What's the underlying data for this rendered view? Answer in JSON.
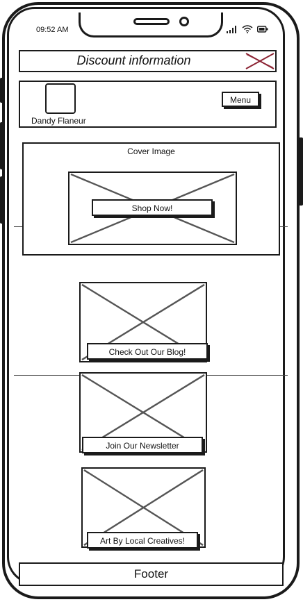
{
  "status_bar": {
    "time": "09:52 AM",
    "icons": [
      "signal-icon",
      "wifi-icon",
      "battery-icon"
    ]
  },
  "discount_bar": {
    "text": "Discount information",
    "close_icon": "close-icon",
    "close_color": "#8b2232"
  },
  "header": {
    "logo_icon": "logo-placeholder",
    "brand_name": "Dandy Flaneur",
    "menu_label": "Menu"
  },
  "cover": {
    "label": "Cover Image",
    "cta_label": "Shop Now!"
  },
  "cards": [
    {
      "label": "Check Out Our Blog!"
    },
    {
      "label": "Join Our Newsletter"
    },
    {
      "label": "Art By Local Creatives!"
    }
  ],
  "footer": {
    "text": "Footer"
  }
}
